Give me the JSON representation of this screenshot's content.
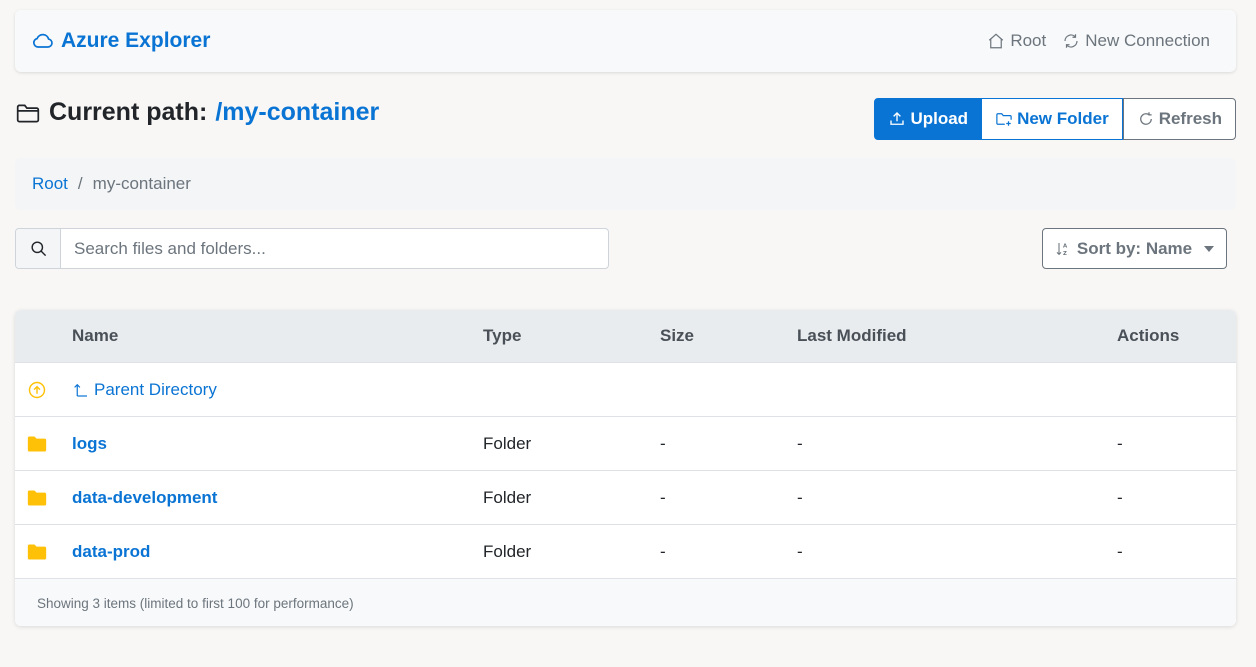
{
  "nav": {
    "brand": "Azure Explorer",
    "root_label": "Root",
    "new_connection_label": "New Connection"
  },
  "path": {
    "prefix": "Current path:",
    "value": "/my-container"
  },
  "toolbar": {
    "upload_label": "Upload",
    "new_folder_label": "New Folder",
    "refresh_label": "Refresh"
  },
  "breadcrumb": {
    "root": "Root",
    "separator": "/",
    "current": "my-container"
  },
  "search": {
    "placeholder": "Search files and folders..."
  },
  "sort": {
    "label": "Sort by: Name"
  },
  "table": {
    "headers": {
      "name": "Name",
      "type": "Type",
      "size": "Size",
      "modified": "Last Modified",
      "actions": "Actions"
    },
    "parent_label": "Parent Directory",
    "rows": [
      {
        "name": "logs",
        "type": "Folder",
        "size": "-",
        "modified": "-",
        "actions": "-"
      },
      {
        "name": "data-development",
        "type": "Folder",
        "size": "-",
        "modified": "-",
        "actions": "-"
      },
      {
        "name": "data-prod",
        "type": "Folder",
        "size": "-",
        "modified": "-",
        "actions": "-"
      }
    ],
    "footer": "Showing 3 items (limited to first 100 for performance)"
  },
  "colors": {
    "accent": "#0a74d4",
    "folder": "#ffc107",
    "muted": "#6c757d"
  }
}
